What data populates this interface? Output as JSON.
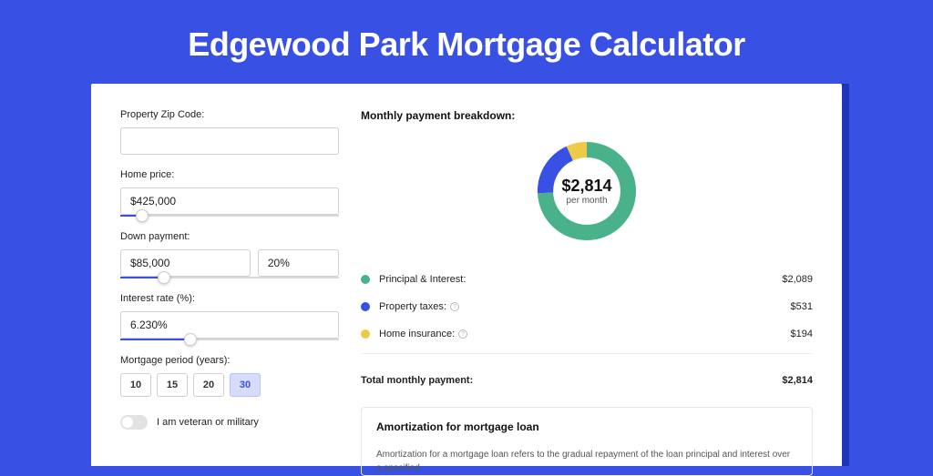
{
  "title": "Edgewood Park Mortgage Calculator",
  "form": {
    "zip_label": "Property Zip Code:",
    "zip_value": "",
    "home_price_label": "Home price:",
    "home_price_value": "$425,000",
    "home_price_slider_pct": 10,
    "down_payment_label": "Down payment:",
    "down_payment_value": "$85,000",
    "down_payment_pct_value": "20%",
    "down_payment_slider_pct": 20,
    "interest_label": "Interest rate (%):",
    "interest_value": "6.230%",
    "interest_slider_pct": 32,
    "period_label": "Mortgage period (years):",
    "period_options": [
      "10",
      "15",
      "20",
      "30"
    ],
    "period_selected": "30",
    "veteran_label": "I am veteran or military"
  },
  "breakdown": {
    "title": "Monthly payment breakdown:",
    "monthly_amount": "$2,814",
    "monthly_sub": "per month",
    "items": [
      {
        "color": "#4ab28a",
        "label": "Principal & Interest:",
        "value": "$2,089",
        "info": false
      },
      {
        "color": "#3950e5",
        "label": "Property taxes:",
        "value": "$531",
        "info": true
      },
      {
        "color": "#eeca4a",
        "label": "Home insurance:",
        "value": "$194",
        "info": true
      }
    ],
    "total_label": "Total monthly payment:",
    "total_value": "$2,814"
  },
  "chart_data": {
    "type": "pie",
    "title": "Monthly payment breakdown",
    "series": [
      {
        "name": "Principal & Interest",
        "value": 2089,
        "color": "#4ab28a"
      },
      {
        "name": "Property taxes",
        "value": 531,
        "color": "#3950e5"
      },
      {
        "name": "Home insurance",
        "value": 194,
        "color": "#eeca4a"
      }
    ],
    "total": 2814,
    "center_label": "$2,814",
    "center_sub": "per month"
  },
  "amortization": {
    "title": "Amortization for mortgage loan",
    "text": "Amortization for a mortgage loan refers to the gradual repayment of the loan principal and interest over a specified"
  }
}
